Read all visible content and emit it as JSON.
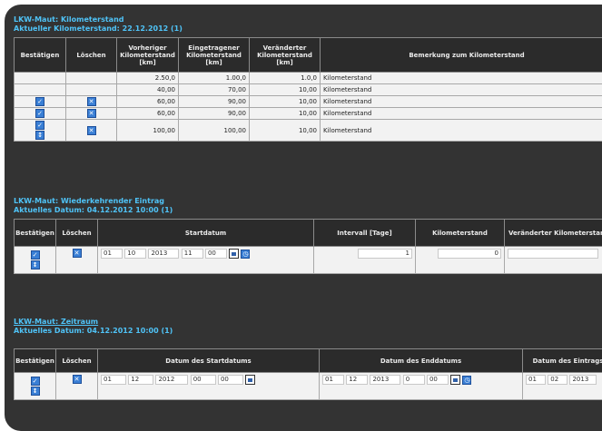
{
  "section1": {
    "title": "LKW-Maut: Kilometerstand",
    "subtitle": "Aktueller Kilometerstand: 22.12.2012 (1)",
    "headers": [
      "Bestätigen",
      "Löschen",
      "Vorheriger Kilometerstand [km]",
      "Eingetragener Kilometerstand [km]",
      "Veränderter Kilometerstand [km]",
      "Bemerkung zum Kilometerstand"
    ],
    "rows": [
      {
        "c3": "2.50,0",
        "c4": "1.00,0",
        "c5": "1.0,0",
        "remark": "Kilometerstand",
        "actions": false
      },
      {
        "c3": "40,00",
        "c4": "70,00",
        "c5": "10,00",
        "remark": "Kilometerstand",
        "actions": false
      },
      {
        "c3": "60,00",
        "c4": "90,00",
        "c5": "10,00",
        "remark": "Kilometerstand",
        "actions": true
      },
      {
        "c3": "60,00",
        "c4": "90,00",
        "c5": "10,00",
        "remark": "Kilometerstand",
        "actions": true
      },
      {
        "c3": "100,00",
        "c4": "100,00",
        "c5": "10,00",
        "remark": "Kilometerstand",
        "actions": true
      }
    ]
  },
  "section2": {
    "title": "LKW-Maut: Wiederkehrender Eintrag",
    "subtitle": "Aktuelles Datum: 04.12.2012 10:00 (1)",
    "headers": [
      "Bestätigen",
      "Löschen",
      "Startdatum",
      "Intervall [Tage]",
      "Kilometerstand",
      "Veränderter Kilometerstand"
    ],
    "row": {
      "day": "01",
      "month": "10",
      "year": "2013",
      "hour": "11",
      "minute": "00",
      "interval": "1",
      "km": "0"
    }
  },
  "section3": {
    "title": "LKW-Maut: Zeitraum",
    "subtitle": "Aktuelles Datum: 04.12.2012 10:00 (1)",
    "headers": [
      "Bestätigen",
      "Löschen",
      "Datum des Startdatums",
      "Datum des Enddatums",
      "Datum des Eintrags"
    ],
    "start": {
      "day": "01",
      "month": "12",
      "year": "2012",
      "hour": "00",
      "minute": "00"
    },
    "end": {
      "day": "01",
      "month": "12",
      "year": "2013",
      "hour": "0",
      "minute": "00"
    },
    "entry": {
      "day": "01",
      "month": "02",
      "year": "2013"
    }
  },
  "colors": {
    "panel": "#333333",
    "accent": "#4fc3f7",
    "button": "#3a7fd5"
  }
}
